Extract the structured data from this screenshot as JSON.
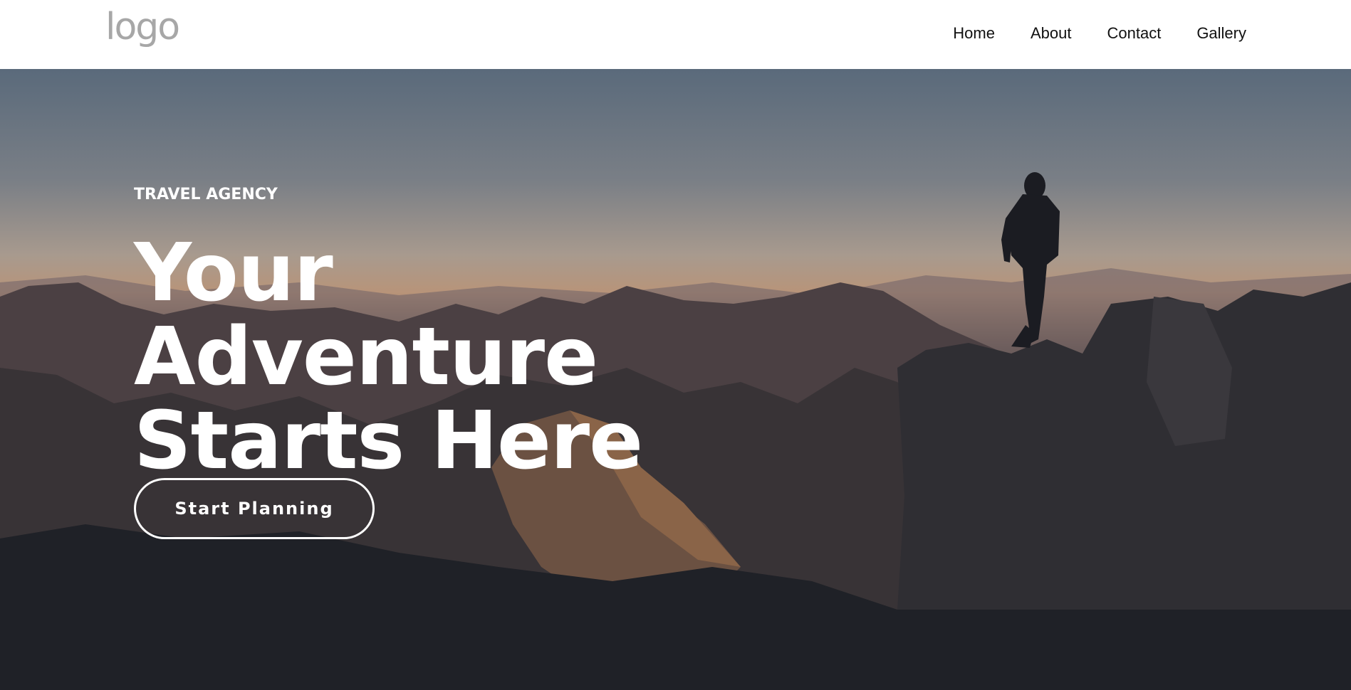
{
  "nav": {
    "logo": "logo",
    "links": [
      "Home",
      "About",
      "Contact",
      "Gallery"
    ]
  },
  "hero": {
    "tagline": "TRAVEL AGENCY",
    "headline_lines": [
      "Your",
      "Adventure",
      "Starts Here"
    ],
    "cta_label": "Start Planning"
  }
}
